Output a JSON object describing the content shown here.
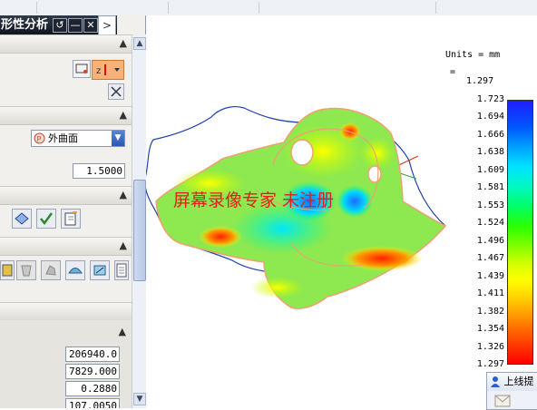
{
  "panel": {
    "title": "形性分析",
    "titlebar_buttons": [
      "↺",
      "—",
      "✕"
    ],
    "tab_arrow": ">",
    "surface_select": "外曲面",
    "fields": {
      "tolerance": "1.5000",
      "value1": "206940.0",
      "value2": "7829.000",
      "value3": "0.2880",
      "value4": "107.0050"
    }
  },
  "view": {
    "units_label": "Units = mm",
    "minus": "=",
    "top_value": "1.297",
    "watermark": "屏幕录像专家  未注册",
    "notify_title": "上线提"
  },
  "chart_data": {
    "type": "heatmap",
    "units": "mm",
    "ticks": [
      "1.723",
      "1.694",
      "1.666",
      "1.638",
      "1.609",
      "1.581",
      "1.553",
      "1.524",
      "1.496",
      "1.467",
      "1.439",
      "1.411",
      "1.382",
      "1.354",
      "1.326",
      "1.297"
    ],
    "range": [
      1.297,
      1.723
    ],
    "colors": [
      "#1f1dff",
      "#00a4ff",
      "#00f6c8",
      "#2dff00",
      "#d4ff00",
      "#ffff00",
      "#ffa600",
      "#ff0000"
    ]
  }
}
